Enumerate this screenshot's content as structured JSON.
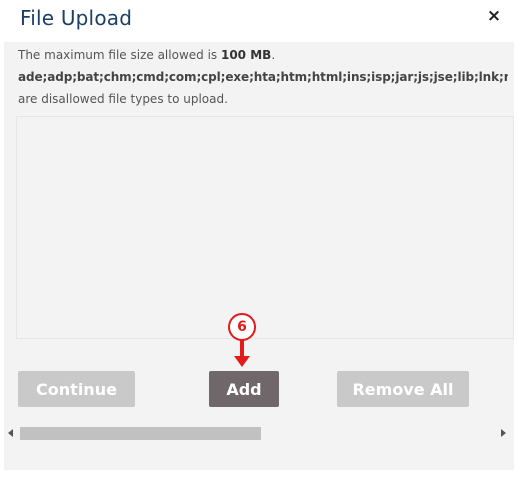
{
  "dialog": {
    "title": "File Upload",
    "close_label": "×"
  },
  "info": {
    "size_prefix": "The maximum file size allowed is ",
    "size_value": "100 MB",
    "size_suffix": ".",
    "disallowed_types": "ade;adp;bat;chm;cmd;com;cpl;exe;hta;htm;html;ins;isp;jar;js;jse;lib;lnk;mde;msc;msp;mst;pif;scr;sct;shb;sys;vb;vbe;vbs;vxd;wsc;wsf;wsh",
    "disallowed_suffix": "are disallowed file types to upload."
  },
  "annotation": {
    "step_number": "6",
    "color": "#e21b1b"
  },
  "buttons": {
    "continue_label": "Continue",
    "add_label": "Add",
    "remove_all_label": "Remove All"
  },
  "scrollbar": {
    "position_fraction": 0.0,
    "visible_fraction": 0.5
  },
  "colors": {
    "title": "#1d3f66",
    "add_button": "#6f6769",
    "disabled_button": "#c9c9c9",
    "panel_background": "#f3f3f3"
  }
}
